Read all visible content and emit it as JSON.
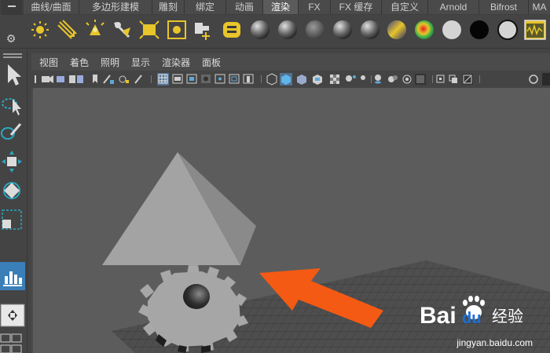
{
  "shelf": {
    "tabs": [
      "曲线/曲面",
      "多边形建模",
      "雕刻",
      "绑定",
      "动画",
      "渲染",
      "FX",
      "FX 缓存",
      "自定义",
      "Arnold",
      "Bifrost",
      "MA"
    ],
    "active_tab": "渲染",
    "icons": [
      "point-light-icon",
      "directional-light-icon",
      "spot-light-icon",
      "area-light-icon",
      "volume-light-icon",
      "ambient-light-icon",
      "camera-aim-icon",
      "hypershade-icon",
      "blinn-sphere-icon",
      "lambert-sphere-icon",
      "phong-sphere-icon",
      "anisotropic-sphere-icon",
      "ramp-shader-icon",
      "surface-shader-icon",
      "toon-sphere-icon",
      "white-sphere-icon",
      "black-sphere-icon",
      "gray-sphere-icon",
      "render-view-icon"
    ]
  },
  "toolbox": {
    "tools": [
      "select-tool-icon",
      "lasso-tool-icon",
      "paint-select-icon",
      "move-tool-icon",
      "rotate-tool-icon",
      "scale-tool-icon",
      "graph-editor-icon",
      "layout-icon"
    ]
  },
  "panel": {
    "menu": [
      "视图",
      "着色",
      "照明",
      "显示",
      "渲染器",
      "面板"
    ]
  },
  "watermark": {
    "logo_text_left": "Bai",
    "logo_text_right": "du",
    "brand_cn": "经验",
    "url": "jingyan.baidu.com"
  },
  "colors": {
    "arrow": "#f45a13",
    "active_tab": "#5b5b5b",
    "viewport_bg": "#5c5c5c"
  }
}
